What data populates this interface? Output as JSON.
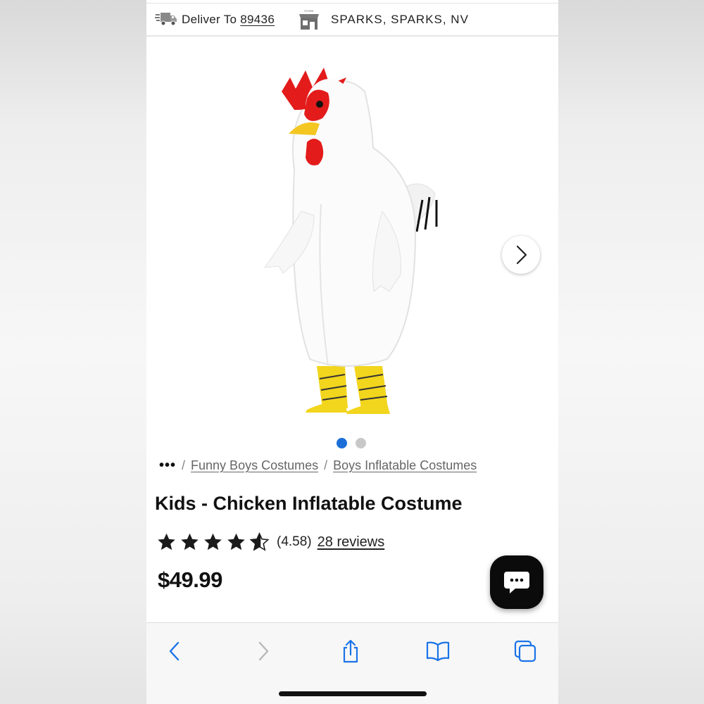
{
  "header": {
    "deliver_label": "Deliver To ",
    "zip": "89436",
    "store_name": "SPARKS, SPARKS, NV",
    "store_icon_text": "STORE"
  },
  "gallery": {
    "image_alt": "Kids - Chicken Inflatable Costume",
    "image_count": 2,
    "active_index": 0
  },
  "breadcrumb": {
    "more": "•••",
    "separator": "/",
    "items": [
      "Funny Boys Costumes",
      "Boys Inflatable Costumes"
    ]
  },
  "product": {
    "title": "Kids - Chicken Inflatable Costume",
    "rating_value": 4.58,
    "rating_text": "(4.58)",
    "reviews_text": "28 reviews",
    "price": "$49.99"
  },
  "toolbar": {
    "items": [
      "back-icon",
      "forward-icon",
      "share-icon",
      "bookmarks-icon",
      "tabs-icon"
    ]
  },
  "colors": {
    "accent_blue": "#1b6ed8",
    "safari_blue": "#1a73e8",
    "chat_button": "#0b0b0b"
  }
}
